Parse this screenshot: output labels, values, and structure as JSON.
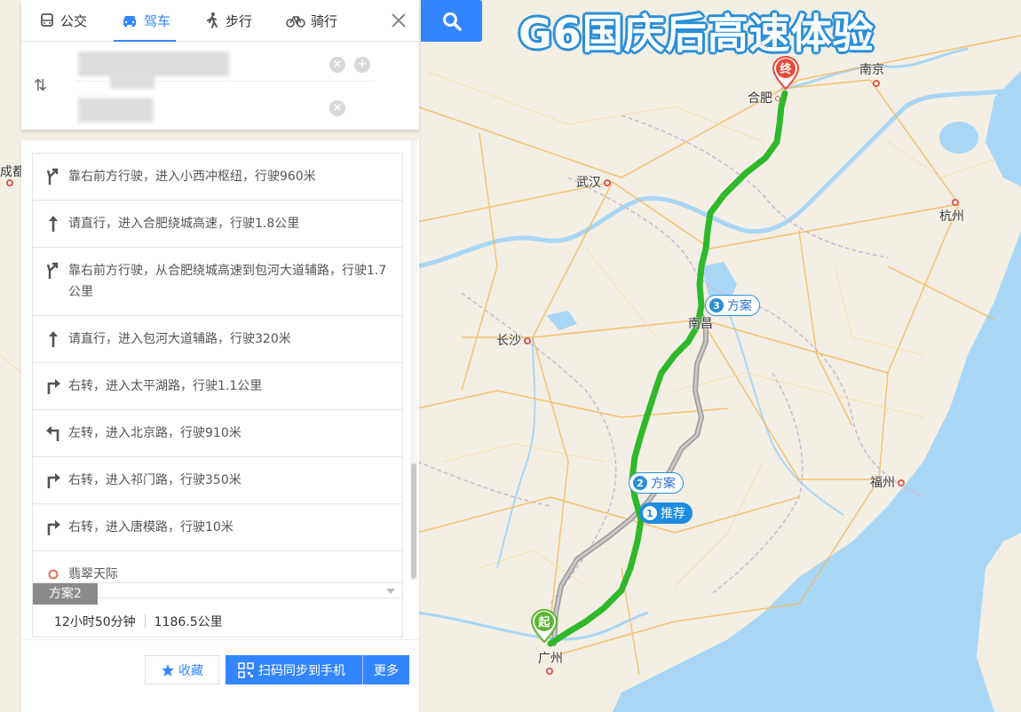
{
  "map": {
    "title": "G6国庆后高速体验",
    "cities": [
      {
        "name": "合肥",
        "id": "hefei"
      },
      {
        "name": "南京",
        "id": "nanjing"
      },
      {
        "name": "武汉",
        "id": "wuhan"
      },
      {
        "name": "杭州",
        "id": "hangzhou"
      },
      {
        "name": "南昌",
        "id": "nanchang"
      },
      {
        "name": "长沙",
        "id": "changsha"
      },
      {
        "name": "福州",
        "id": "fuzhou"
      },
      {
        "name": "广州",
        "id": "guangzhou"
      },
      {
        "name": "成都",
        "id": "chengdu"
      }
    ],
    "route_labels": {
      "plan3_num": "3",
      "plan3_text": "方案",
      "plan2_num": "2",
      "plan2_text": "方案",
      "plan1_num": "1",
      "plan1_text": "推荐"
    },
    "start_marker": "起",
    "end_marker": "终",
    "colors": {
      "main_route": "#2fb82a",
      "alt_route": "#a0a0a0",
      "water": "#a9d6f5",
      "accent": "#3385ff"
    }
  },
  "search": {
    "modes": [
      {
        "label": "公交",
        "icon": "bus-icon"
      },
      {
        "label": "驾车",
        "icon": "car-icon",
        "active": true
      },
      {
        "label": "步行",
        "icon": "walk-icon"
      },
      {
        "label": "骑行",
        "icon": "bike-icon"
      }
    ],
    "swap_label": "⇅"
  },
  "steps": [
    {
      "icon": "keep-right-icon",
      "text": "靠右前方行驶，进入小西冲枢纽，行驶960米"
    },
    {
      "icon": "straight-icon",
      "text": "请直行，进入合肥绕城高速，行驶1.8公里"
    },
    {
      "icon": "keep-right-icon",
      "text": "靠右前方行驶，从合肥绕城高速到包河大道辅路，行驶1.7公里"
    },
    {
      "icon": "straight-icon",
      "text": "请直行，进入包河大道辅路，行驶320米"
    },
    {
      "icon": "turn-right-icon",
      "text": "右转，进入太平湖路，行驶1.1公里"
    },
    {
      "icon": "turn-left-icon",
      "text": "左转，进入北京路，行驶910米"
    },
    {
      "icon": "turn-right-icon",
      "text": "右转，进入祁门路，行驶350米"
    },
    {
      "icon": "turn-right-icon",
      "text": "右转，进入唐模路，行驶10米"
    },
    {
      "icon": "destination-icon",
      "text": "翡翠天际"
    }
  ],
  "plan2": {
    "tag": "方案2",
    "duration": "12小时50分钟",
    "distance": "1186.5公里"
  },
  "actions": {
    "favorite": "收藏",
    "sync": "扫码同步到手机",
    "more": "更多"
  }
}
